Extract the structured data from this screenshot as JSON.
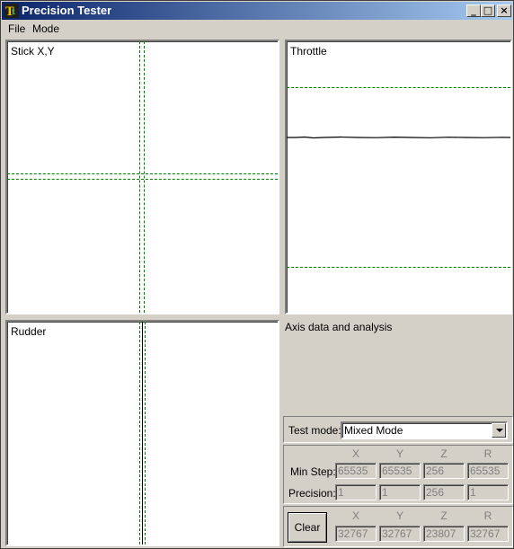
{
  "window": {
    "title": "Precision Tester"
  },
  "title_buttons": {
    "minimize": "_",
    "maximize": "□",
    "close": "×"
  },
  "menu": [
    "File",
    "Mode"
  ],
  "panels": {
    "stick": {
      "label": "Stick X,Y"
    },
    "throttle": {
      "label": "Throttle"
    },
    "rudder": {
      "label": "Rudder"
    }
  },
  "analysis": {
    "label": "Axis data and analysis"
  },
  "test_mode": {
    "label": "Test mode:",
    "value": "Mixed Mode"
  },
  "stats": {
    "columns": [
      "X",
      "Y",
      "Z",
      "R"
    ],
    "min_step_label": "Min Step:",
    "min_step": [
      "65535",
      "65535",
      "256",
      "65535"
    ],
    "precision_label": "Precision:",
    "precision": [
      "1",
      "1",
      "256",
      "1"
    ]
  },
  "current": {
    "clear_label": "Clear",
    "columns": [
      "X",
      "Y",
      "Z",
      "R"
    ],
    "values": [
      "32767",
      "32767",
      "23807",
      "32767"
    ]
  },
  "colors": {
    "guide": "#008000",
    "title_start": "#0a246a",
    "title_end": "#a6caf0"
  }
}
